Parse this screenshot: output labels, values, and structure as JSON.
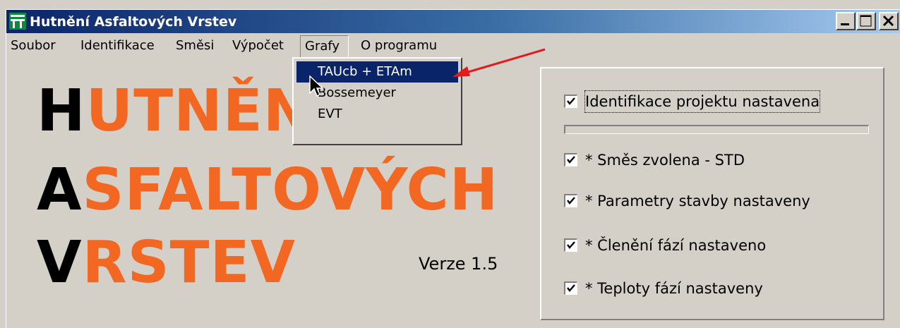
{
  "window": {
    "title": "Hutnění Asfaltových Vrstev",
    "icon": "app-logo-icon"
  },
  "menubar": {
    "items": [
      "Soubor",
      "Identifikace",
      "Směsi",
      "Výpočet",
      "Grafy",
      "O programu"
    ],
    "open_menu": "Grafy"
  },
  "grafy_menu": {
    "items": [
      "TAUcb + ETAm",
      "Bossemeyer",
      "EVT"
    ],
    "highlighted": "TAUcb + ETAm"
  },
  "logo": {
    "lines": [
      {
        "first": "H",
        "rest": "UTNĚNÍ"
      },
      {
        "first": "A",
        "rest": "SFALTOVÝCH"
      },
      {
        "first": "V",
        "rest": "RSTEV"
      }
    ],
    "colors": {
      "first_letter": "#000000",
      "rest": "#f26722"
    }
  },
  "version": "Verze 1.5",
  "status_panel": {
    "project_id": {
      "label": "Identifikace projektu nastavena",
      "checked": true
    },
    "items": [
      {
        "label": "* Směs zvolena - STD",
        "checked": true
      },
      {
        "label": "* Parametry stavby nastaveny",
        "checked": true
      },
      {
        "label": "* Členění fází nastaveno",
        "checked": true
      },
      {
        "label": "* Teploty fází nastaveny",
        "checked": true
      }
    ]
  },
  "colors": {
    "titlebar_start": "#0a246a",
    "titlebar_end": "#a6caf0",
    "menu_highlight": "#0a246a",
    "accent_orange": "#f26722",
    "annotation_arrow": "#e31b1b"
  }
}
